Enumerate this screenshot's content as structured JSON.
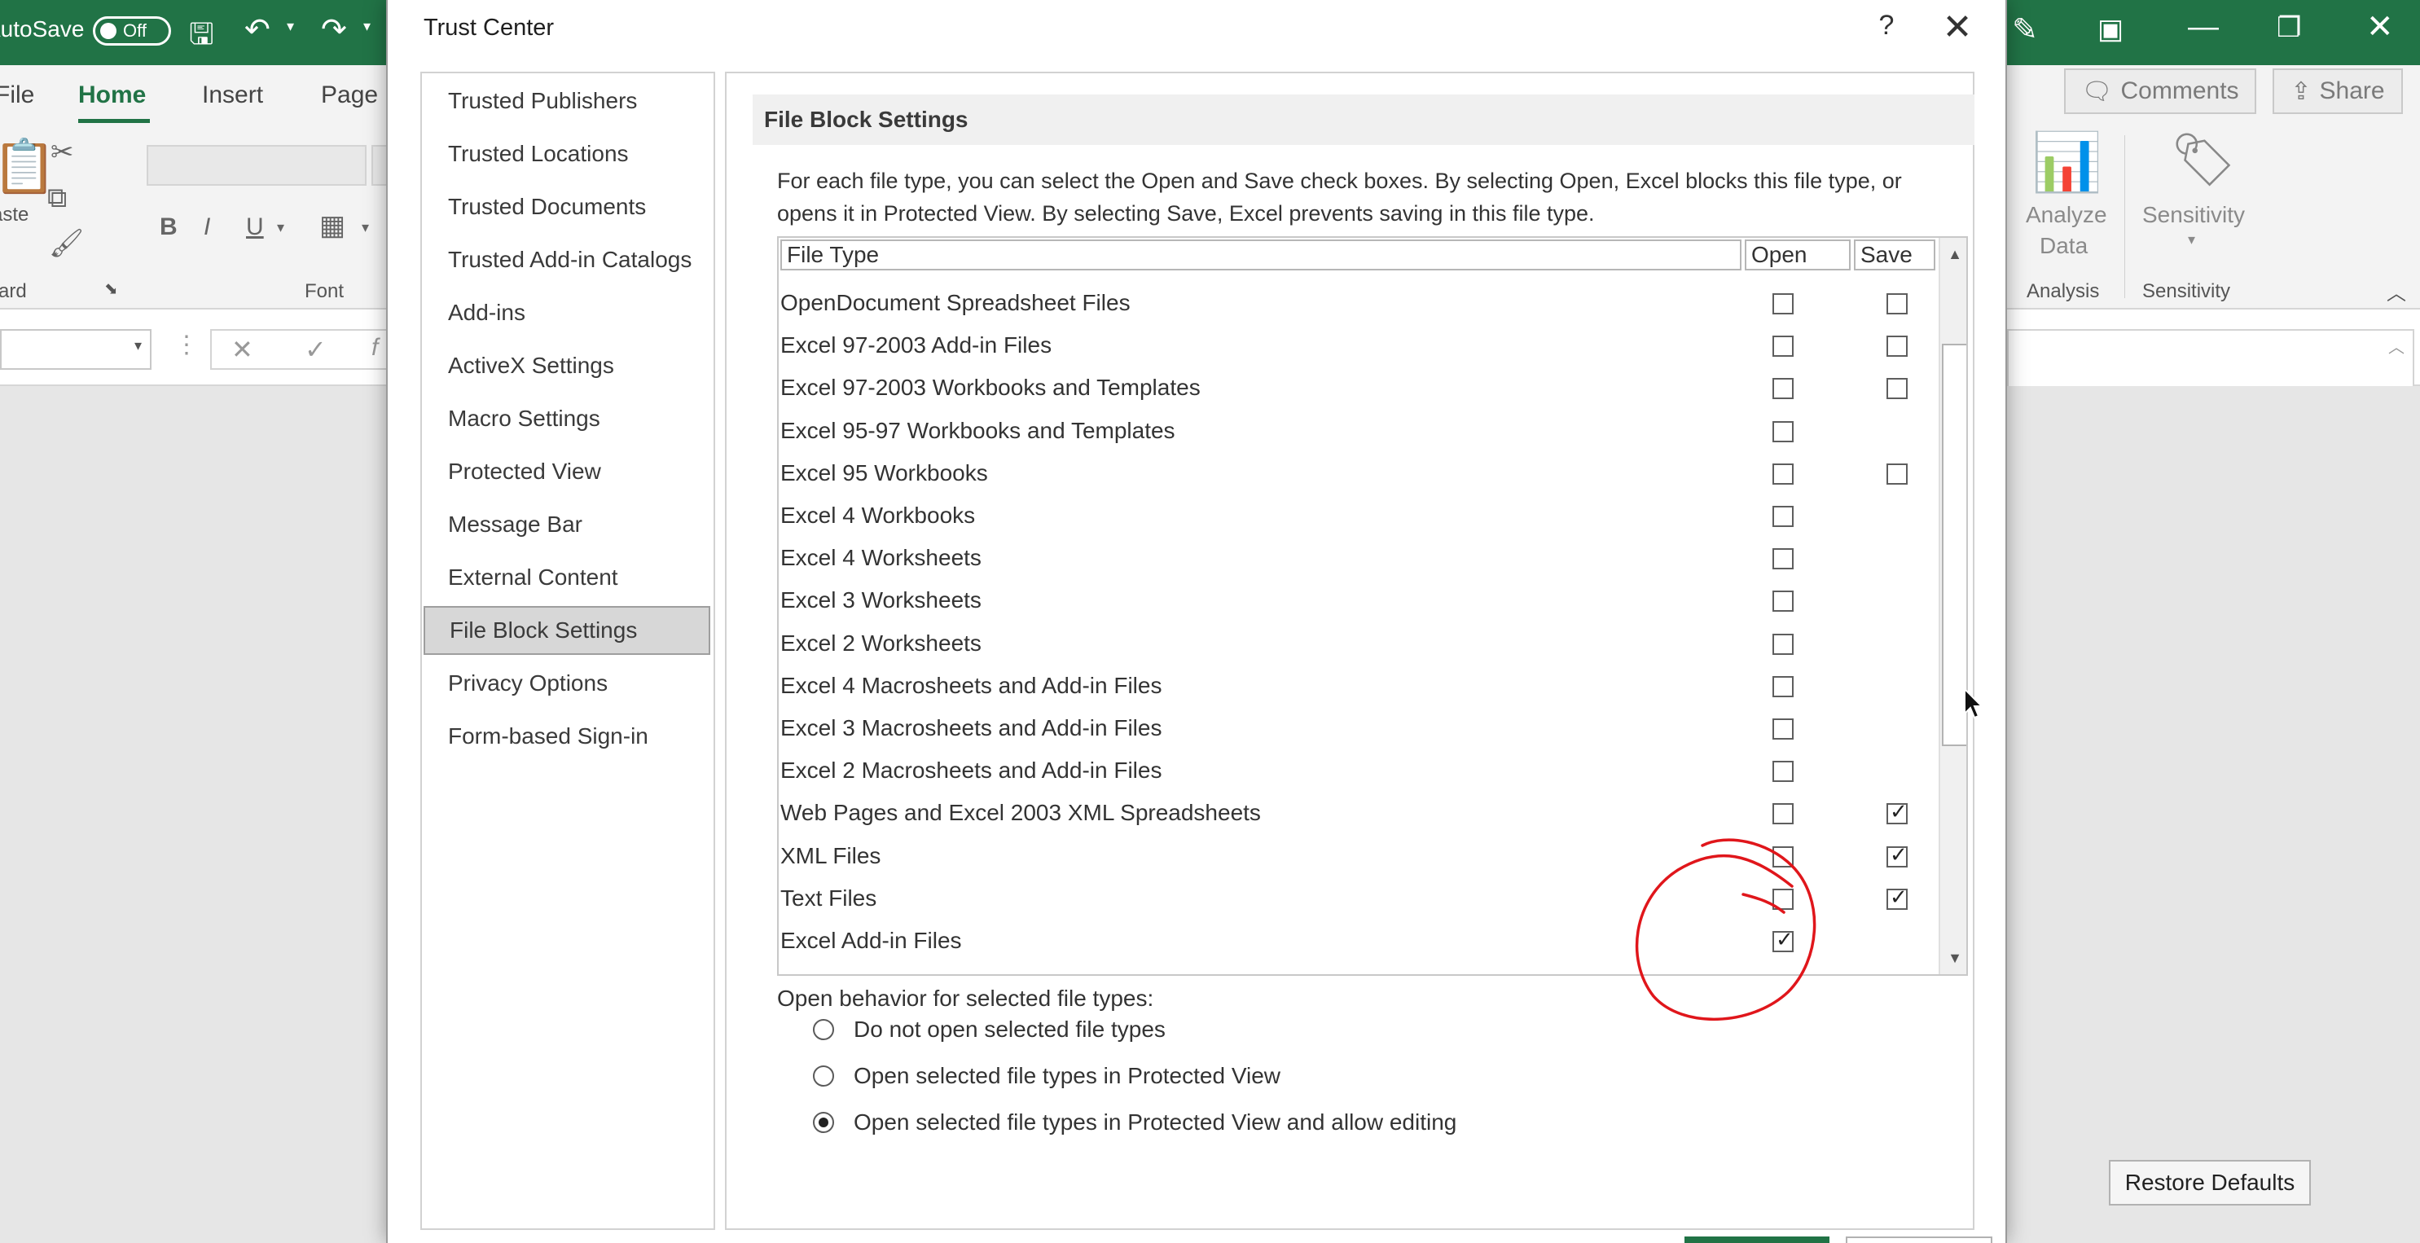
{
  "excel": {
    "autosave_label": "AutoSave",
    "autosave_toggle": "Off",
    "ribbon_tabs": [
      "File",
      "Home",
      "Insert",
      "Page Layout"
    ],
    "active_tab": "Home",
    "comments_label": "Comments",
    "share_label": "Share",
    "groups": {
      "clipboard": "Clipboard",
      "paste": "Paste",
      "font": "Font",
      "analysis": "Analysis",
      "sensitivity": "Sensitivity"
    },
    "analyze_data_label": [
      "Analyze",
      "Data"
    ],
    "sensitivity_button": "Sensitivity",
    "font_buttons": [
      "B",
      "I",
      "U"
    ],
    "accent_color": "#217346"
  },
  "dialog": {
    "title": "Trust Center",
    "help": "?",
    "close": "✕",
    "nav": [
      "Trusted Publishers",
      "Trusted Locations",
      "Trusted Documents",
      "Trusted Add-in Catalogs",
      "Add-ins",
      "ActiveX Settings",
      "Macro Settings",
      "Protected View",
      "Message Bar",
      "External Content",
      "File Block Settings",
      "Privacy Options",
      "Form-based Sign-in"
    ],
    "selected_nav": "File Block Settings",
    "section_title": "File Block Settings",
    "description": "For each file type, you can select the Open and Save check boxes. By selecting Open, Excel blocks this file type, or opens it in Protected View. By selecting Save, Excel prevents saving in this file type.",
    "table_headers": {
      "file_type": "File Type",
      "open": "Open",
      "save": "Save"
    },
    "rows": [
      {
        "name": "OpenDocument Spreadsheet Files",
        "open": false,
        "save": false
      },
      {
        "name": "Excel 97-2003 Add-in Files",
        "open": false,
        "save": false
      },
      {
        "name": "Excel 97-2003 Workbooks and Templates",
        "open": false,
        "save": false
      },
      {
        "name": "Excel 95-97 Workbooks and Templates",
        "open": false,
        "save": null
      },
      {
        "name": "Excel 95 Workbooks",
        "open": false,
        "save": false
      },
      {
        "name": "Excel 4 Workbooks",
        "open": false,
        "save": null
      },
      {
        "name": "Excel 4 Worksheets",
        "open": false,
        "save": null
      },
      {
        "name": "Excel 3 Worksheets",
        "open": false,
        "save": null
      },
      {
        "name": "Excel 2 Worksheets",
        "open": false,
        "save": null
      },
      {
        "name": "Excel 4 Macrosheets and Add-in Files",
        "open": false,
        "save": null
      },
      {
        "name": "Excel 3 Macrosheets and Add-in Files",
        "open": false,
        "save": null
      },
      {
        "name": "Excel 2 Macrosheets and Add-in Files",
        "open": false,
        "save": null
      },
      {
        "name": "Web Pages and Excel 2003 XML Spreadsheets",
        "open": false,
        "save": true
      },
      {
        "name": "XML Files",
        "open": false,
        "save": true
      },
      {
        "name": "Text Files",
        "open": false,
        "save": true
      },
      {
        "name": "Excel Add-in Files",
        "open": true,
        "save": null
      }
    ],
    "open_behavior_label": "Open behavior for selected file types:",
    "open_behavior_options": [
      "Do not open selected file types",
      "Open selected file types in Protected View",
      "Open selected file types in Protected View and allow editing"
    ],
    "selected_behavior": 2,
    "restore_defaults": "Restore Defaults",
    "annotation_color": "#e0161b"
  }
}
